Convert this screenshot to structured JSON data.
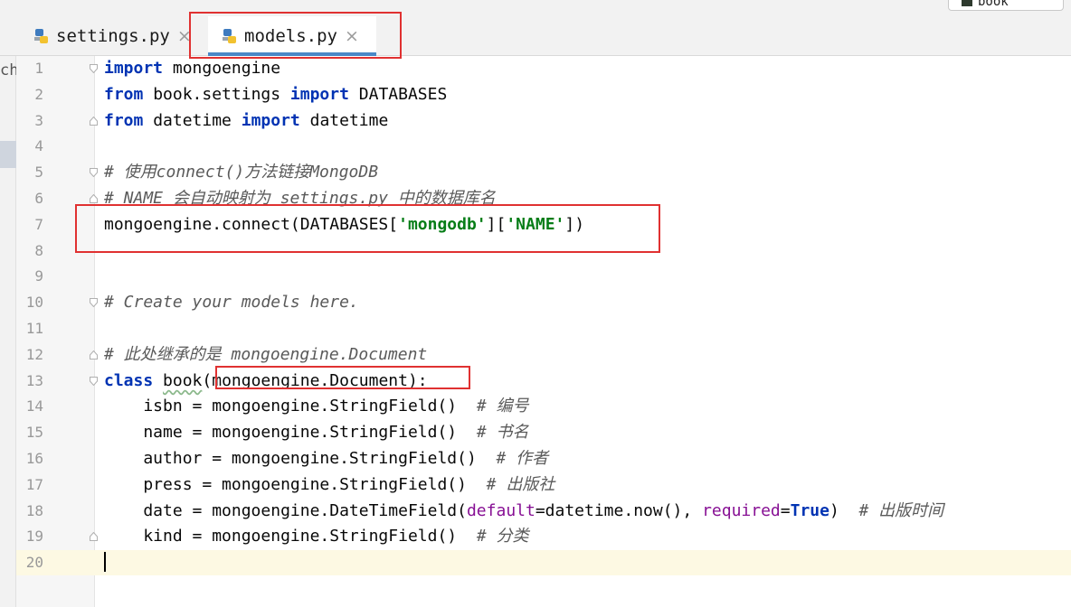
{
  "top_button": {
    "label": "book"
  },
  "tabs": [
    {
      "label": "settings.py",
      "active": false
    },
    {
      "label": "models.py",
      "active": true
    }
  ],
  "left_strip_text": "ch",
  "line_numbers": [
    "1",
    "2",
    "3",
    "4",
    "5",
    "6",
    "7",
    "8",
    "9",
    "10",
    "11",
    "12",
    "13",
    "14",
    "15",
    "16",
    "17",
    "18",
    "19",
    "20"
  ],
  "code": {
    "l1_kw": "import",
    "l1_rest": " mongoengine",
    "l2_kw1": "from",
    "l2_mid": " book.settings ",
    "l2_kw2": "import",
    "l2_rest": " DATABASES",
    "l3_kw1": "from",
    "l3_mid": " datetime ",
    "l3_kw2": "import",
    "l3_rest": " datetime",
    "l5_comment": "# 使用connect()方法链接MongoDB",
    "l6_comment": "# NAME 会自动映射为 settings.py 中的数据库名",
    "l7_a": "mongoengine.connect(DATABASES[",
    "l7_s1": "'mongodb'",
    "l7_b": "][",
    "l7_s2": "'NAME'",
    "l7_c": "])",
    "l10_comment": "# Create your models here.",
    "l12_comment": "# 此处继承的是 mongoengine.Document",
    "l13_kw": "class",
    "l13_sp": " ",
    "l13_name": "book",
    "l13_rest": "(mongoengine.Document):",
    "l14_code": "    isbn = mongoengine.StringField()  ",
    "l14_comment": "# 编号",
    "l15_code": "    name = mongoengine.StringField()  ",
    "l15_comment": "# 书名",
    "l16_code": "    author = mongoengine.StringField()  ",
    "l16_comment": "# 作者",
    "l17_code": "    press = mongoengine.StringField()  ",
    "l17_comment": "# 出版社",
    "l18_a": "    date = mongoengine.DateTimeField(",
    "l18_p1": "default",
    "l18_b": "=datetime.now(), ",
    "l18_p2": "required",
    "l18_eq": "=",
    "l18_true": "True",
    "l18_c": ")  ",
    "l18_comment": "# 出版时间",
    "l19_code": "    kind = mongoengine.StringField()  ",
    "l19_comment": "# 分类"
  },
  "colors": {
    "keyword": "#0033b3",
    "string": "#067d17",
    "comment": "#5a5a5a",
    "param": "#871094",
    "highlight_box": "#e03131",
    "tab_underline": "#4a88c7"
  }
}
